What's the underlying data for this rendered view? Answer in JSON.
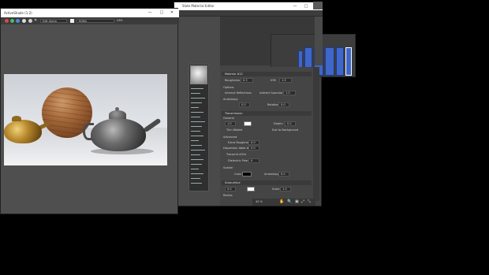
{
  "material_editor": {
    "title": "Slate Material Editor",
    "zoom": "40 %",
    "rollouts": {
      "basic_label": "Material #12",
      "roughness_label": "Roughness",
      "roughness_value": "0.3",
      "ior_label": "IOR:",
      "ior_value": "1.5",
      "options_label": "Options",
      "internal_reflections": "Internal Reflections",
      "indirect_specular": "Indirect Specular:",
      "indirect_value": "1.0",
      "anisotropy_label": "Anisotropy",
      "aniso_value": "0.0",
      "rotation_label": "Rotation:",
      "rotation_value": "0.0",
      "transmission_label": "Transmission",
      "general_label": "General",
      "trans_weight": "1.0",
      "depth_label": "Depth:",
      "depth_value": "0.0",
      "thin_walled": "Thin Walled",
      "exit_to_background": "Exit to Background",
      "advanced_label": "Advanced",
      "extra_roughness": "Extra Roughness",
      "extra_roughness_value": "0.0",
      "dispersion_abbe": "Dispersion Abbe #",
      "dispersion_value": "0.0",
      "transmit_aovs": "Transmit AOVs",
      "dielectric_priority": "Dielectric Priority",
      "dielectric_value": "0",
      "scatter_label": "Scatter",
      "color_label": "Color",
      "anisotropy2_label": "Anisotropy",
      "anisotropy2_value": "0.0",
      "subsurface_label": "Subsurface",
      "subsurface_value": "0.0",
      "scale_label": "Scale",
      "scale_value": "1.0",
      "radius_label": "Radius"
    }
  },
  "activeshade": {
    "title": "ActiveShade (1:2)",
    "area_label": "Edit Alpha",
    "channel_label": "RGBA",
    "device_label": "GPU"
  },
  "colors": {
    "node_blue": "#3f67c9",
    "gold": "#b5862a",
    "wood": "#a86b3c"
  }
}
